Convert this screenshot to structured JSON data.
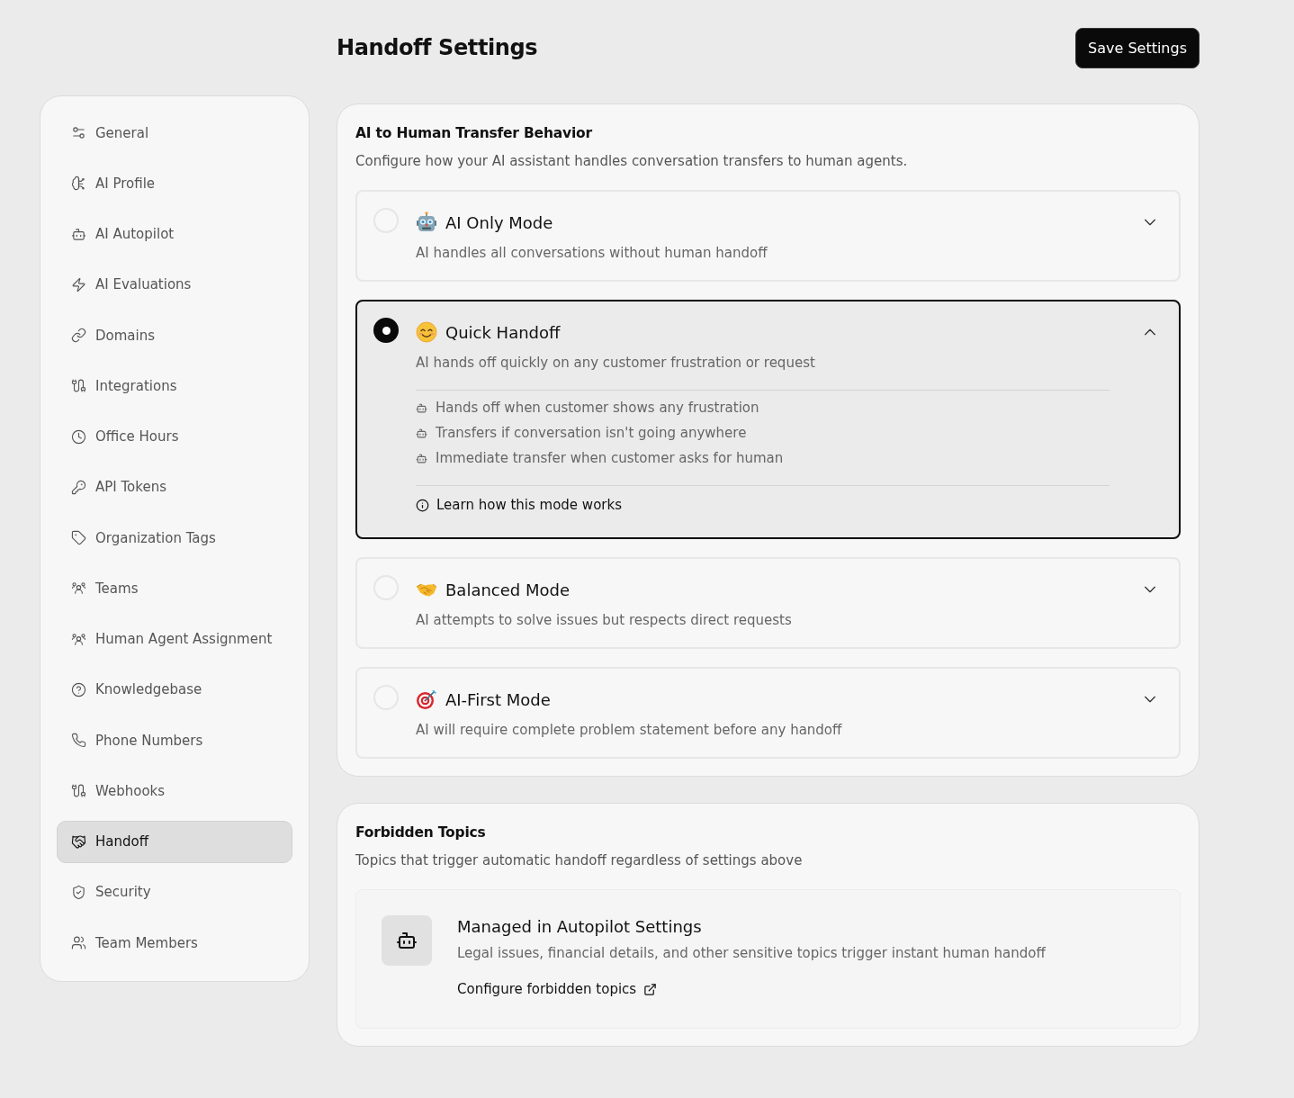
{
  "header": {
    "title": "Handoff Settings",
    "save_button": "Save Settings"
  },
  "sidebar": {
    "items": [
      {
        "label": "General",
        "selected": false
      },
      {
        "label": "AI Profile",
        "selected": false
      },
      {
        "label": "AI Autopilot",
        "selected": false
      },
      {
        "label": "AI Evaluations",
        "selected": false
      },
      {
        "label": "Domains",
        "selected": false
      },
      {
        "label": "Integrations",
        "selected": false
      },
      {
        "label": "Office Hours",
        "selected": false
      },
      {
        "label": "API Tokens",
        "selected": false
      },
      {
        "label": "Organization Tags",
        "selected": false
      },
      {
        "label": "Teams",
        "selected": false
      },
      {
        "label": "Human Agent Assignment",
        "selected": false
      },
      {
        "label": "Knowledgebase",
        "selected": false
      },
      {
        "label": "Phone Numbers",
        "selected": false
      },
      {
        "label": "Webhooks",
        "selected": false
      },
      {
        "label": "Handoff",
        "selected": true
      },
      {
        "label": "Security",
        "selected": false
      },
      {
        "label": "Team Members",
        "selected": false
      }
    ]
  },
  "transfer_behavior": {
    "title": "AI to Human Transfer Behavior",
    "description": "Configure how your AI assistant handles conversation transfers to human agents.",
    "modes": [
      {
        "title": "AI Only Mode",
        "description": "AI handles all conversations without human handoff",
        "selected": false,
        "expanded": false
      },
      {
        "title": "Quick Handoff",
        "description": "AI hands off quickly on any customer frustration or request",
        "selected": true,
        "expanded": true,
        "features": [
          "Hands off when customer shows any frustration",
          "Transfers if conversation isn't going anywhere",
          "Immediate transfer when customer asks for human"
        ],
        "learn_link": "Learn how this mode works"
      },
      {
        "title": "Balanced Mode",
        "description": "AI attempts to solve issues but respects direct requests",
        "selected": false,
        "expanded": false
      },
      {
        "title": "AI-First Mode",
        "description": "AI will require complete problem statement before any handoff",
        "selected": false,
        "expanded": false
      }
    ]
  },
  "forbidden_topics": {
    "title": "Forbidden Topics",
    "description": "Topics that trigger automatic handoff regardless of settings above",
    "managed": {
      "title": "Managed in Autopilot Settings",
      "description": "Legal issues, financial details, and other sensitive topics trigger instant human handoff",
      "link": "Configure forbidden topics"
    }
  }
}
